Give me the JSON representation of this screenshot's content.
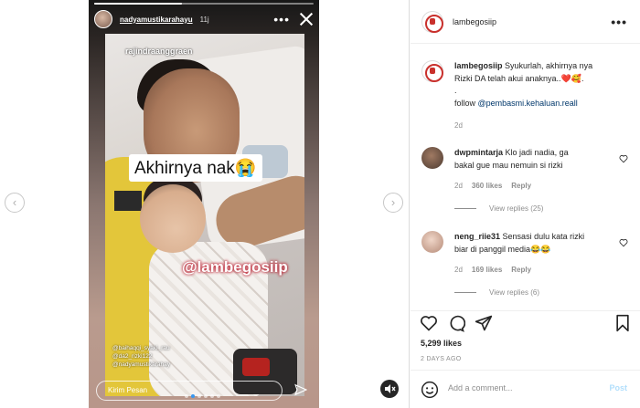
{
  "story": {
    "username": "nadyamustikarahayu",
    "time": "11j",
    "tag_sticker": "rajindraanggraen",
    "caption_sticker": "Akhirnya nak😭",
    "mention_sticker": "@lambegosiip",
    "tagged_users": [
      "@baihaqqi_syaki_rau",
      "@da2_rizki122",
      "@nadyamustikarahay"
    ],
    "reply_placeholder": "Kirim Pesan"
  },
  "post": {
    "header_username": "lambegosiip",
    "caption": {
      "username": "lambegosiip",
      "text_line1": "Syukurlah, akhirnya nya",
      "text_line2": "Rizki DA telah akui anaknya..❤️🥰.",
      "text_dot": ".",
      "follow_prefix": "follow ",
      "follow_handle": "@pembasmi.kehaluan.reall",
      "age": "2d"
    },
    "comments": [
      {
        "username": "dwpmintarja",
        "text_line1": "Klo jadi nadia, ga",
        "text_line2": "bakal gue mau nemuin si rizki",
        "age": "2d",
        "likes": "360 likes",
        "reply": "Reply",
        "view_replies": "View replies (25)"
      },
      {
        "username": "neng_riie31",
        "text_line1": "Sensasi dulu kata rizki",
        "text_line2": "biar di panggil media😂😂",
        "age": "2d",
        "likes": "169 likes",
        "reply": "Reply",
        "view_replies": "View replies (6)"
      }
    ],
    "likes": "5,299 likes",
    "date": "2 DAYS AGO",
    "add_comment_placeholder": "Add a comment...",
    "post_label": "Post"
  },
  "nav": {
    "prev": "‹",
    "next": "›"
  },
  "colors": {
    "link": "#00376b",
    "muted": "#8e8e8e",
    "text": "#262626",
    "post_disabled": "#b2dffc"
  },
  "icons": [
    "heart-icon",
    "comment-icon",
    "share-icon",
    "bookmark-icon",
    "emoji-icon",
    "mute-icon",
    "send-icon",
    "close-icon",
    "more-icon"
  ]
}
